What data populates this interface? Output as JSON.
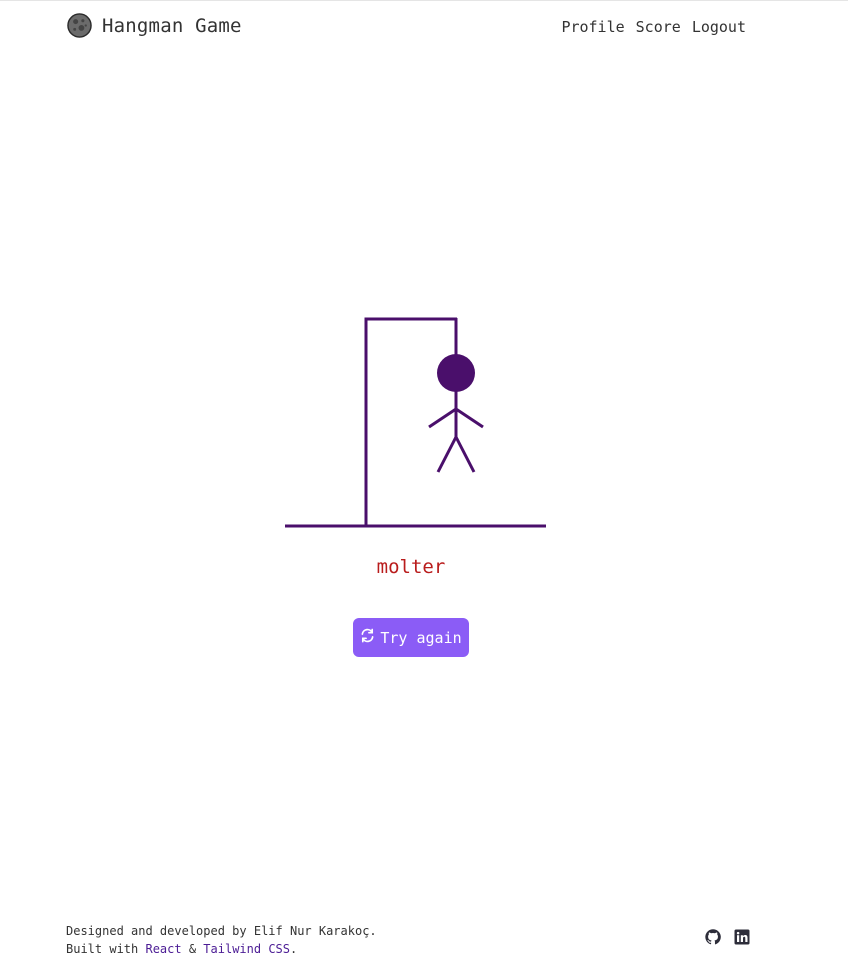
{
  "header": {
    "title": "Hangman Game",
    "logo_icon": "moon-icon",
    "nav": {
      "profile": "Profile",
      "score": "Score",
      "logout": "Logout"
    }
  },
  "game": {
    "answer_word": "molter",
    "try_again_label": "Try again",
    "try_again_icon": "refresh-icon",
    "figure_color": "#4a0f6b",
    "answer_color": "#b91c1c",
    "button_color": "#8b5cf6"
  },
  "footer": {
    "credit_line": "Designed and developed by Elif Nur Karakoç.",
    "built_prefix": "Built with ",
    "react_label": "React",
    "amp": " & ",
    "tailwind_label": "Tailwind CSS",
    "built_suffix": ".",
    "icons": [
      "github-icon",
      "linkedin-icon"
    ]
  }
}
